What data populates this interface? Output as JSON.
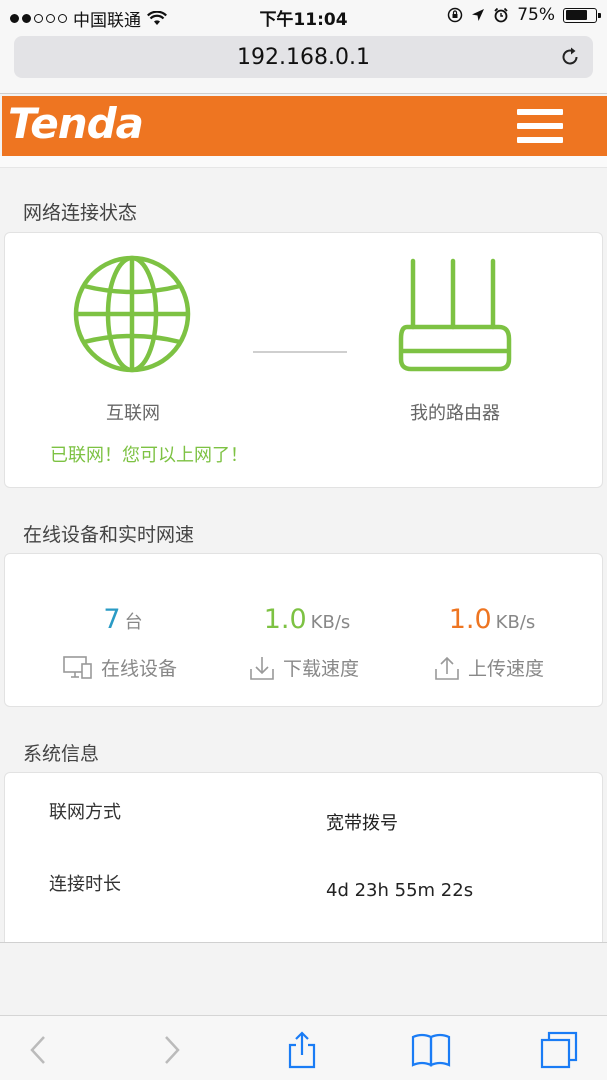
{
  "status_bar": {
    "carrier": "中国联通",
    "time": "下午11:04",
    "battery_percent": "75%",
    "battery_level": 0.75,
    "signal_bars_filled": 2,
    "signal_bars_total": 5
  },
  "browser": {
    "url": "192.168.0.1"
  },
  "header": {
    "logo_text": "Tenda",
    "brand_color": "#ee7521"
  },
  "network_status": {
    "section_title": "网络连接状态",
    "internet_label": "互联网",
    "router_label": "我的路由器",
    "status_message": "已联网！您可以上网了！",
    "status_color": "#7dc243"
  },
  "online_devices": {
    "section_title": "在线设备和实时网速",
    "devices": {
      "value": "7",
      "unit": "台",
      "label": "在线设备",
      "color": "#2a9bc5"
    },
    "download": {
      "value": "1.0",
      "unit": "KB/s",
      "label": "下载速度",
      "color": "#7dc243"
    },
    "upload": {
      "value": "1.0",
      "unit": "KB/s",
      "label": "上传速度",
      "color": "#ee7521"
    }
  },
  "system_info": {
    "section_title": "系统信息",
    "rows": [
      {
        "label": "联网方式",
        "value": "宽带拨号"
      },
      {
        "label": "连接时长",
        "value": "4d 23h 55m 22s"
      }
    ]
  },
  "toolbar": {
    "icons": [
      "back-icon",
      "forward-icon",
      "share-icon",
      "bookmarks-icon",
      "tabs-icon"
    ]
  }
}
